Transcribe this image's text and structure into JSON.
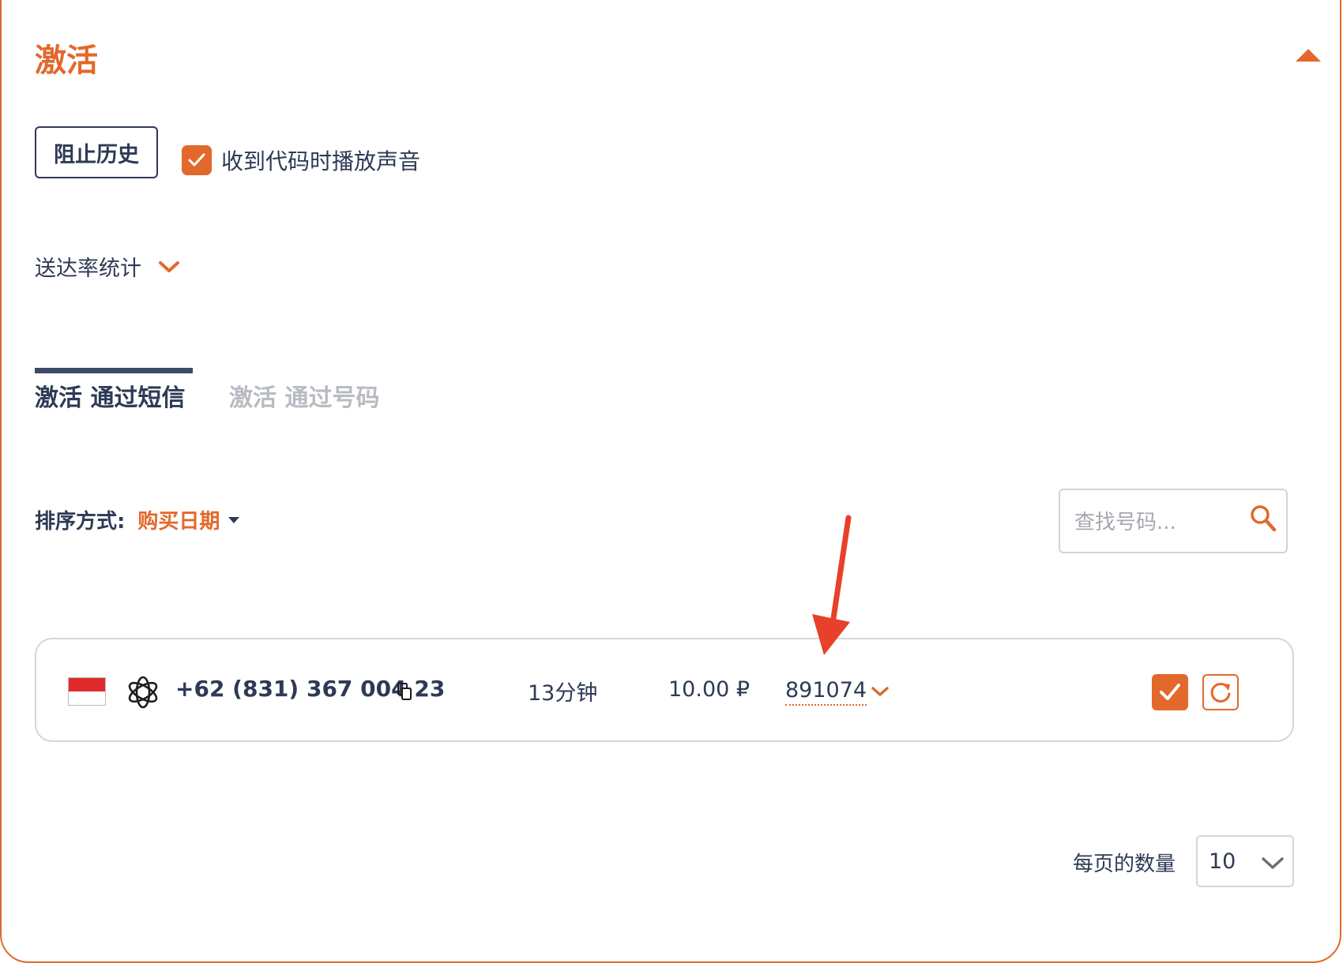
{
  "section": {
    "title": "激活",
    "collapse_icon": "caret-up-icon"
  },
  "controls": {
    "block_history_label": "阻止历史",
    "sound_checkbox_label": "收到代码时播放声音",
    "sound_checkbox_checked": true
  },
  "stats": {
    "label": "送达率统计"
  },
  "tabs": [
    {
      "label": "激活 通过短信",
      "active": true
    },
    {
      "label": "激活 通过号码",
      "active": false
    }
  ],
  "sort": {
    "label": "排序方式:",
    "value": "购买日期"
  },
  "search": {
    "placeholder": "查找号码..."
  },
  "activations": [
    {
      "country_flag": "indonesia-flag",
      "service_icon": "openai-icon",
      "phone": "+62 (831) 367 004 23",
      "time_left": "13分钟",
      "price": "10.00 ₽",
      "code": "891074"
    }
  ],
  "pagination": {
    "per_page_label": "每页的数量",
    "per_page_value": "10"
  },
  "colors": {
    "accent": "#e2692b",
    "text": "#2e3a55",
    "annotation_arrow": "#e8402a"
  }
}
